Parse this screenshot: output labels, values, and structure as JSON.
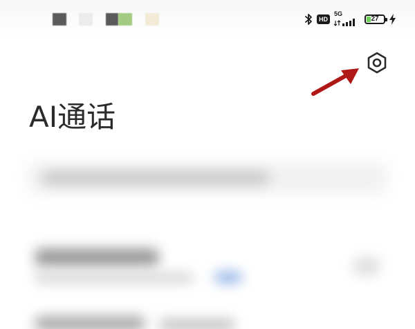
{
  "status_bar": {
    "hd_badge": "HD",
    "network_type": "5G",
    "battery_level": "27",
    "battery_fraction": 0.27,
    "icons": [
      "bluetooth-icon",
      "hd-icon",
      "signal-icon",
      "battery-icon",
      "charging-icon"
    ],
    "notification_colors": [
      "#5b5b5b",
      "#ececec",
      "#5a5a5a",
      "#a3cc82",
      "#f4ead8"
    ]
  },
  "header": {
    "title": "AI通话",
    "settings_icon": "gear-icon"
  },
  "annotation": {
    "icon": "arrow-icon",
    "color": "#b01818"
  },
  "colors": {
    "title": "#2b2b2b",
    "battery_fill": "#6cd35a",
    "background": "#ffffff"
  }
}
